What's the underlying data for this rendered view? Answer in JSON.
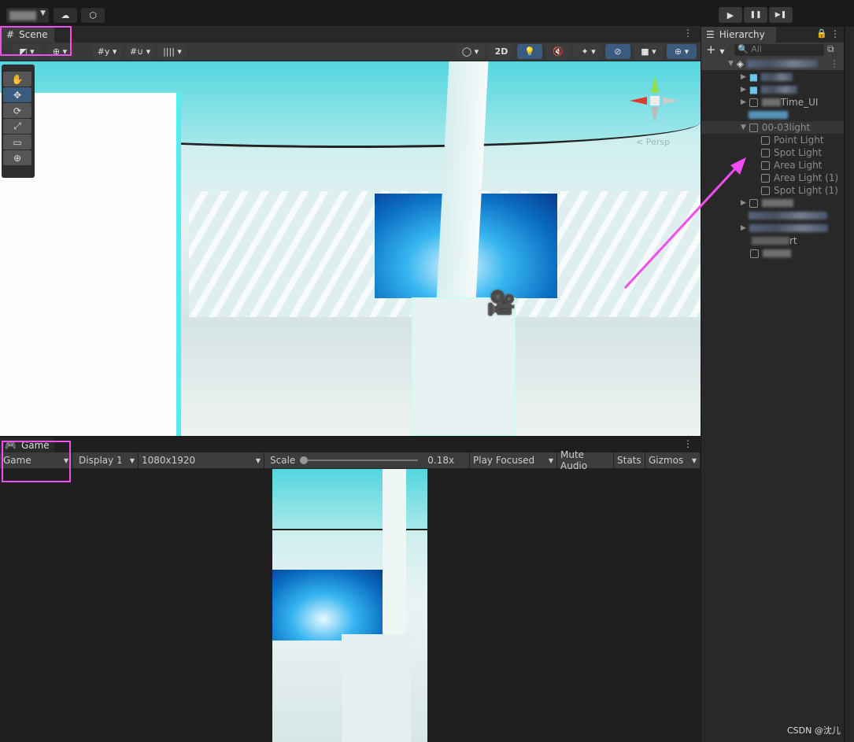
{
  "topbar": {
    "cloud_icon": "cloud-icon",
    "collab_icon": "plastic-scm-icon",
    "play": "▶",
    "pause": "❚❚",
    "step": "▶❚"
  },
  "scene": {
    "tab_label": "Scene",
    "btn_2d": "2D",
    "tools": [
      "✋",
      "✥",
      "⟳",
      "⤢",
      "▭",
      "⊕"
    ],
    "persp_label": "< Persp"
  },
  "game": {
    "tab_label": "Game",
    "view_select": "Game",
    "display": "Display 1",
    "resolution": "1080x1920",
    "scale_label": "Scale",
    "scale_value": "0.18x",
    "scale_fraction": 0.0,
    "play_mode": "Play Focused",
    "mute": "Mute Audio",
    "stats": "Stats",
    "gizmos": "Gizmos"
  },
  "hierarchy": {
    "tab_label": "Hierarchy",
    "search_placeholder": "All",
    "items": [
      {
        "label": "Time_UI",
        "depth": 1
      },
      {
        "label": "00-03light",
        "depth": 1,
        "expanded": true,
        "selected": true
      },
      {
        "label": "Point Light",
        "depth": 2
      },
      {
        "label": "Spot Light",
        "depth": 2
      },
      {
        "label": "Area Light",
        "depth": 2
      },
      {
        "label": "Area Light (1)",
        "depth": 2
      },
      {
        "label": "Spot Light (1)",
        "depth": 2
      },
      {
        "label": "rt",
        "depth": 1
      }
    ]
  },
  "colors": {
    "annotation": "#f24df2",
    "accent": "#3a5a7e"
  },
  "watermark": "CSDN @沈儿"
}
